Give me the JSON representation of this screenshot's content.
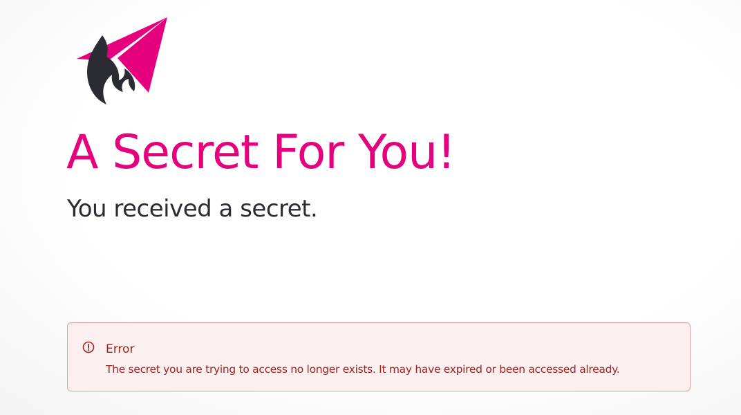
{
  "logo": {
    "icon": "flame-paper-plane-logo",
    "colors": {
      "plane": "#e5007e",
      "flame": "#2b2b33"
    }
  },
  "header": {
    "title": "A Secret For You!",
    "subtitle": "You received a secret."
  },
  "alert": {
    "icon": "exclamation-circle-icon",
    "title": "Error",
    "message": "The secret you are trying to access no longer exists. It may have expired or been accessed already."
  },
  "colors": {
    "accent": "#e5007e",
    "text": "#2b2b33",
    "error_text": "#a3211f",
    "error_border": "#e0a3a3",
    "error_bg": "#fbf0ef"
  }
}
